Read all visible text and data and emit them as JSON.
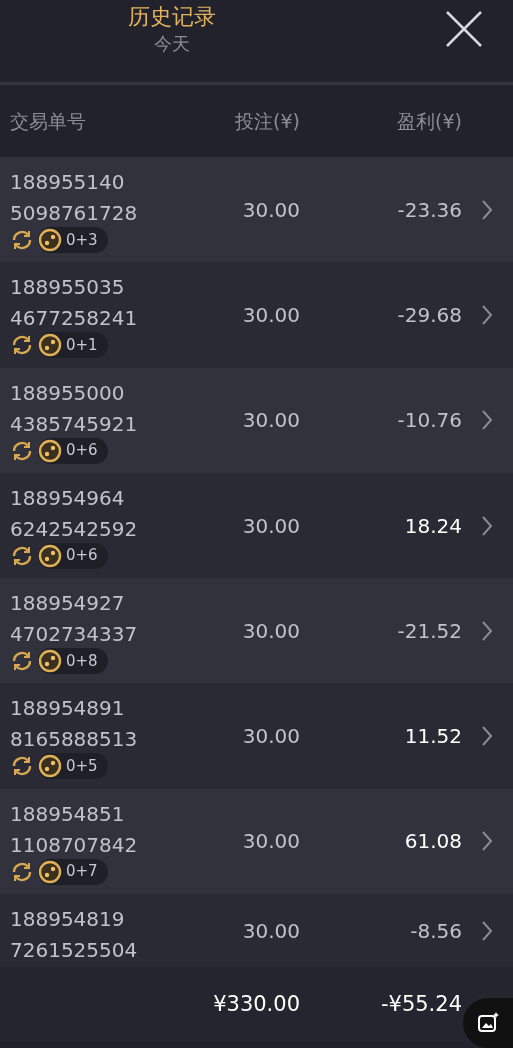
{
  "header": {
    "title": "历史记录",
    "subtitle": "今天"
  },
  "table": {
    "columns": [
      "交易单号",
      "投注(¥)",
      "盈利(¥)"
    ],
    "rows": [
      {
        "order": [
          "188955140",
          "5098761728"
        ],
        "tag": "0+3",
        "stake": "30.00",
        "profit": "-23.36",
        "won": false
      },
      {
        "order": [
          "188955035",
          "4677258241"
        ],
        "tag": "0+1",
        "stake": "30.00",
        "profit": "-29.68",
        "won": false
      },
      {
        "order": [
          "188955000",
          "4385745921"
        ],
        "tag": "0+6",
        "stake": "30.00",
        "profit": "-10.76",
        "won": false
      },
      {
        "order": [
          "188954964",
          "6242542592"
        ],
        "tag": "0+6",
        "stake": "30.00",
        "profit": "18.24",
        "won": true
      },
      {
        "order": [
          "188954927",
          "4702734337"
        ],
        "tag": "0+8",
        "stake": "30.00",
        "profit": "-21.52",
        "won": false
      },
      {
        "order": [
          "188954891",
          "8165888513"
        ],
        "tag": "0+5",
        "stake": "30.00",
        "profit": "11.52",
        "won": true
      },
      {
        "order": [
          "188954851",
          "1108707842"
        ],
        "tag": "0+7",
        "stake": "30.00",
        "profit": "61.08",
        "won": true
      },
      {
        "order": [
          "188954819",
          "7261525504"
        ],
        "stake": "30.00",
        "profit": "-8.56",
        "won": false
      }
    ]
  },
  "totals": {
    "stake": "¥330.00",
    "profit": "-¥55.24"
  }
}
